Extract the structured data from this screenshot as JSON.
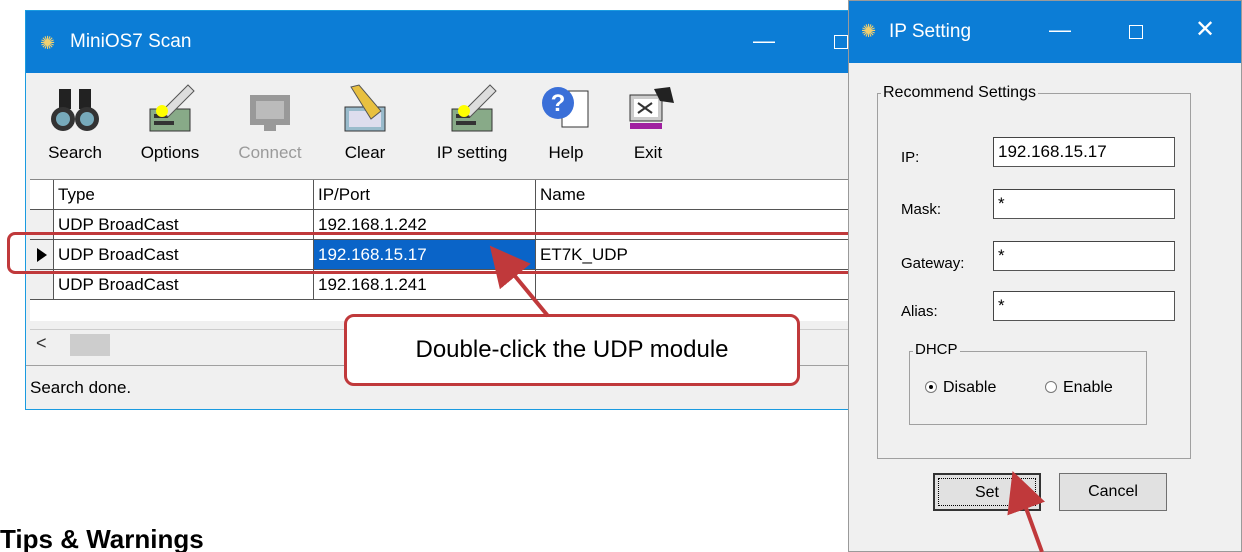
{
  "main_window": {
    "title": "MiniOS7 Scan",
    "toolbar": [
      {
        "id": "search",
        "label": "Search",
        "icon": "binoculars-icon"
      },
      {
        "id": "options",
        "label": "Options",
        "icon": "options-icon"
      },
      {
        "id": "connect",
        "label": "Connect",
        "icon": "connect-icon",
        "disabled": true
      },
      {
        "id": "clear",
        "label": "Clear",
        "icon": "broom-icon"
      },
      {
        "id": "ipsetting",
        "label": "IP setting",
        "icon": "ip-setting-icon"
      },
      {
        "id": "help",
        "label": "Help",
        "icon": "help-icon"
      },
      {
        "id": "exit",
        "label": "Exit",
        "icon": "exit-icon"
      }
    ],
    "table": {
      "headers": [
        "Type",
        "IP/Port",
        "Name"
      ],
      "rows": [
        {
          "type": "UDP BroadCast",
          "ip": "192.168.1.242",
          "name": ""
        },
        {
          "type": "UDP BroadCast",
          "ip": "192.168.15.17",
          "name": "ET7K_UDP",
          "selected": true
        },
        {
          "type": "UDP BroadCast",
          "ip": "192.168.1.241",
          "name": ""
        }
      ]
    },
    "status": "Search done."
  },
  "callout": "Double-click the UDP module",
  "ip_dialog": {
    "title": "IP Setting",
    "group_title": "Recommend Settings",
    "fields": {
      "ip": {
        "label": "IP:",
        "value": "192.168.15.17"
      },
      "mask": {
        "label": "Mask:",
        "value": "*"
      },
      "gateway": {
        "label": "Gateway:",
        "value": "*"
      },
      "alias": {
        "label": "Alias:",
        "value": "*"
      }
    },
    "dhcp": {
      "title": "DHCP",
      "disable": "Disable",
      "enable": "Enable",
      "selected": "Disable"
    },
    "set_label": "Set",
    "cancel_label": "Cancel"
  },
  "tips_heading": "Tips & Warnings",
  "colors": {
    "titlebar": "#0c7dd6",
    "highlight": "#c0393b",
    "selection": "#0a64c8"
  }
}
